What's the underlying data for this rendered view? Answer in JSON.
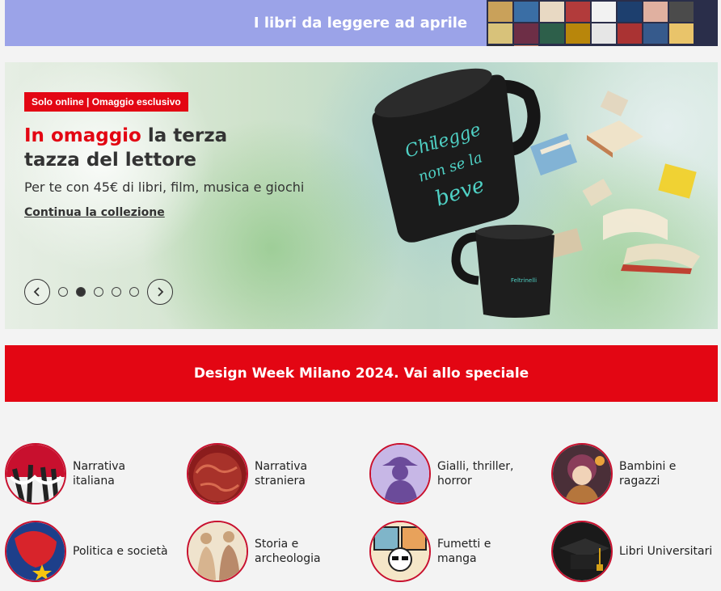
{
  "top_banner": {
    "title": "I libri da leggere ad aprile"
  },
  "hero": {
    "tag": "Solo online | Omaggio esclusivo",
    "headline_red": "In omaggio",
    "headline_rest_1": " la terza",
    "headline_line2": "tazza del lettore",
    "subtitle": "Per te con 45€ di libri, film, musica e giochi",
    "link": "Continua la collezione",
    "mug_text_1": "Chi",
    "mug_text_2": "legge",
    "mug_text_3": "non se la",
    "mug_text_4": "beve",
    "small_mug_brand": "Feltrinelli",
    "carousel": {
      "slides": 5,
      "active": 2
    }
  },
  "design_week": {
    "label": "Design Week Milano 2024. Vai allo speciale"
  },
  "categories": [
    {
      "line1": "Narrativa",
      "line2": "italiana",
      "icon": "narrativa-italiana-image"
    },
    {
      "line1": "Narrativa",
      "line2": "straniera",
      "icon": "narrativa-straniera-image"
    },
    {
      "line1": "Gialli, thriller,",
      "line2": "horror",
      "icon": "gialli-image"
    },
    {
      "line1": "Bambini e",
      "line2": "ragazzi",
      "icon": "bambini-image"
    },
    {
      "line1": "Politica e società",
      "line2": "",
      "icon": "politica-image"
    },
    {
      "line1": "Storia e",
      "line2": "archeologia",
      "icon": "storia-image"
    },
    {
      "line1": "Fumetti e",
      "line2": "manga",
      "icon": "fumetti-image"
    },
    {
      "line1": "Libri Universitari",
      "line2": "",
      "icon": "universitari-image"
    }
  ],
  "colors": {
    "brand_red": "#e30613",
    "banner_blue": "#9ba3e8"
  }
}
